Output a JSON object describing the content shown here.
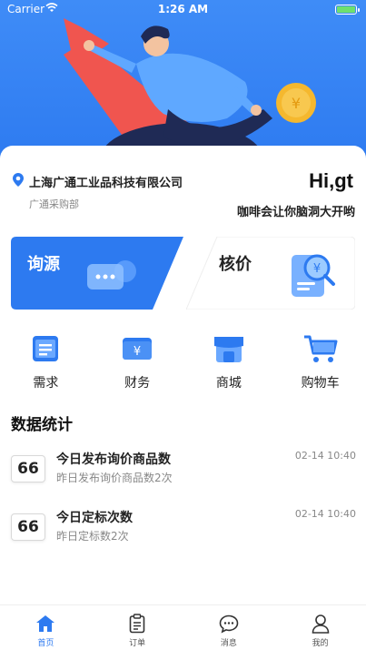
{
  "status_bar": {
    "carrier": "Carrier",
    "time": "1:26 AM"
  },
  "header": {
    "company": "上海广通工业品科技有限公司",
    "department": "广通采购部",
    "greeting": "Hi,gt",
    "slogan": "咖啡会让你脑洞大开哟"
  },
  "cards": {
    "inquiry": {
      "label": "询源"
    },
    "price": {
      "label": "核价"
    }
  },
  "quick_menu": [
    {
      "label": "需求",
      "icon": "document-icon"
    },
    {
      "label": "财务",
      "icon": "wallet-icon"
    },
    {
      "label": "商城",
      "icon": "store-icon"
    },
    {
      "label": "购物车",
      "icon": "cart-icon"
    }
  ],
  "stats": {
    "title": "数据统计",
    "rows": [
      {
        "count": "66",
        "title": "今日发布询价商品数",
        "subtitle": "昨日发布询价商品数2次",
        "time": "02-14 10:40"
      },
      {
        "count": "66",
        "title": "今日定标次数",
        "subtitle": "昨日定标数2次",
        "time": "02-14 10:40"
      }
    ]
  },
  "tabbar": [
    {
      "label": "首页",
      "icon": "home-icon",
      "active": true
    },
    {
      "label": "订单",
      "icon": "order-icon",
      "active": false
    },
    {
      "label": "消息",
      "icon": "message-icon",
      "active": false
    },
    {
      "label": "我的",
      "icon": "profile-icon",
      "active": false
    }
  ],
  "colors": {
    "primary": "#2d7af0",
    "accent_red": "#f0554f",
    "coin": "#f5b82e"
  }
}
